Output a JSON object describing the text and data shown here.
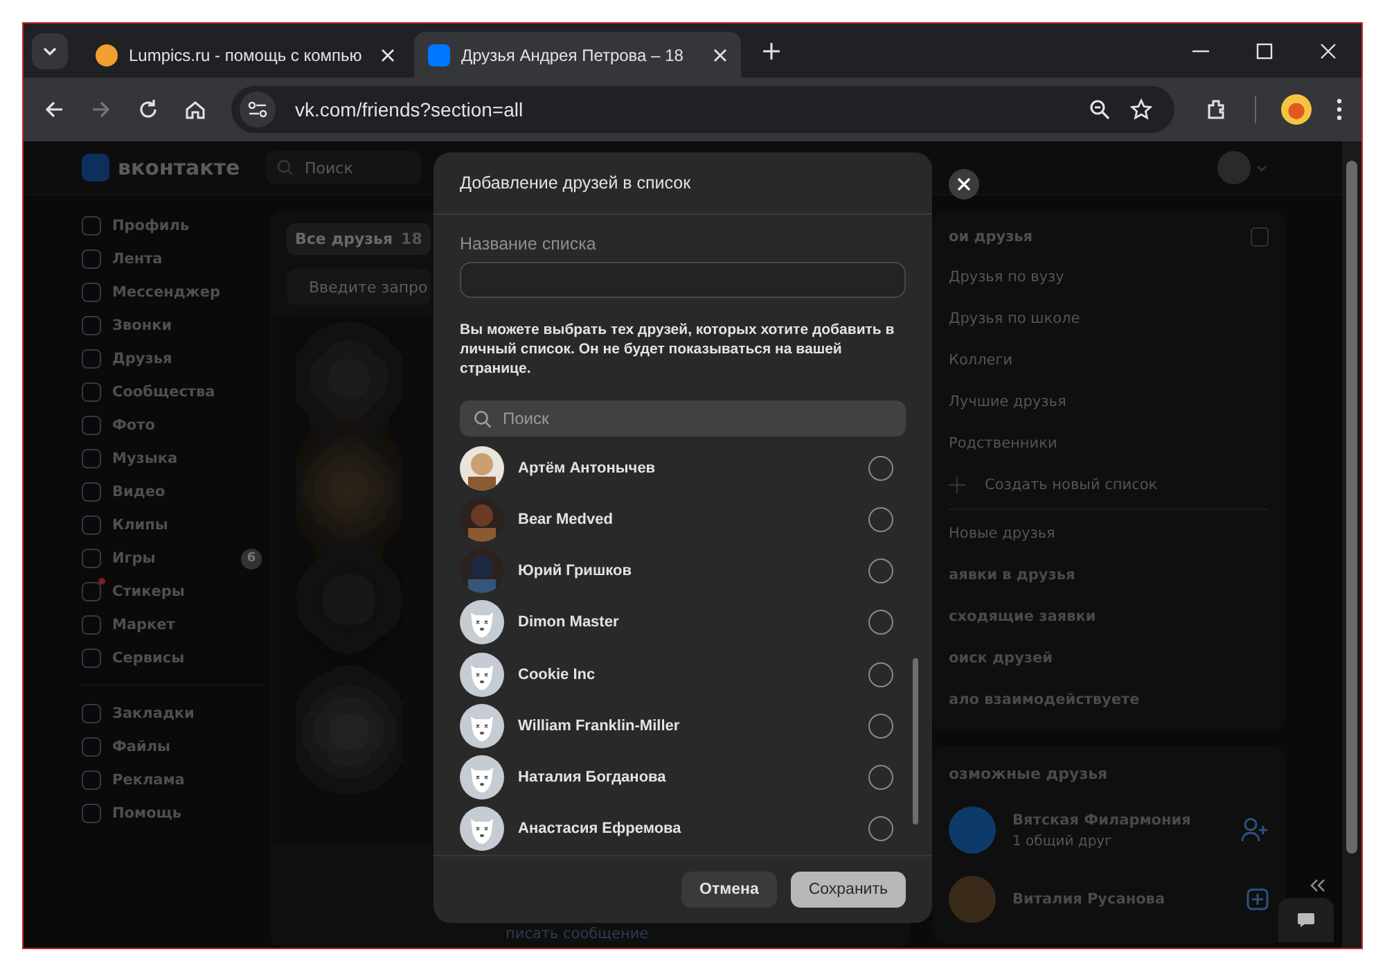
{
  "browser": {
    "tabs": [
      {
        "title": "Lumpics.ru - помощь с компью",
        "selected": false
      },
      {
        "title": "Друзья Андрея Петрова – 18",
        "selected": true
      }
    ],
    "url": "vk.com/friends?section=all"
  },
  "header": {
    "logo": "вконтакте",
    "search_placeholder": "Поиск"
  },
  "sidebar": {
    "groups": [
      [
        {
          "label": "Профиль"
        },
        {
          "label": "Лента"
        },
        {
          "label": "Мессенджер"
        },
        {
          "label": "Звонки"
        },
        {
          "label": "Друзья"
        },
        {
          "label": "Сообщества"
        },
        {
          "label": "Фото"
        },
        {
          "label": "Музыка"
        },
        {
          "label": "Видео"
        },
        {
          "label": "Клипы"
        },
        {
          "label": "Игры",
          "badge": "6"
        },
        {
          "label": "Стикеры",
          "notification": true
        },
        {
          "label": "Маркет"
        },
        {
          "label": "Сервисы"
        }
      ],
      [
        {
          "label": "Закладки"
        },
        {
          "label": "Файлы"
        },
        {
          "label": "Реклама"
        },
        {
          "label": "Помощь"
        }
      ]
    ]
  },
  "center": {
    "tab": {
      "label": "Все друзья",
      "count": "18",
      "selected": true
    },
    "search_placeholder": "Введите запро",
    "footer_link": "писать сообщение"
  },
  "right": {
    "lists_title": "ои друзья",
    "lists": [
      "Друзья по вузу",
      "Друзья по школе",
      "Коллеги",
      "Лучшие друзья",
      "Родственники"
    ],
    "create": "Создать новый список",
    "sections": [
      {
        "label": "Новые друзья",
        "bold": false
      },
      {
        "label": "аявки в друзья",
        "bold": true
      },
      {
        "label": "сходящие заявки",
        "bold": true
      },
      {
        "label": "оиск друзей",
        "bold": true
      },
      {
        "label": "ало взаимодействуете",
        "bold": true
      }
    ],
    "possible": {
      "title": "озможные друзья",
      "people": [
        {
          "name": "Вятская Филармония",
          "subtitle": "1 общий друг",
          "kind": "add"
        },
        {
          "name": "Виталия Русанова",
          "kind": "plus"
        }
      ]
    }
  },
  "modal": {
    "title": "Добавление друзей в список",
    "field_label": "Название списка",
    "description": "Вы можете выбрать тех друзей, которых хотите добавить в личный список. Он не будет показываться на вашей странице.",
    "search_placeholder": "Поиск",
    "friends": [
      {
        "name": "Артём Антонычев",
        "selected": false
      },
      {
        "name": "Bear Medved",
        "selected": false
      },
      {
        "name": "Юрий Гришков",
        "selected": false
      },
      {
        "name": "Dimon Master",
        "kind": "default",
        "selected": false
      },
      {
        "name": "Cookie Inc",
        "kind": "default",
        "selected": false
      },
      {
        "name": "William Franklin-Miller",
        "kind": "default",
        "selected": false
      },
      {
        "name": "Наталия Богданова",
        "kind": "default",
        "selected": false
      },
      {
        "name": "Анастасия Ефремова",
        "kind": "default",
        "selected": false
      }
    ],
    "buttons": [
      {
        "label": "Отмена",
        "kind": "secondary"
      },
      {
        "label": "Сохранить",
        "kind": "primary"
      }
    ]
  }
}
